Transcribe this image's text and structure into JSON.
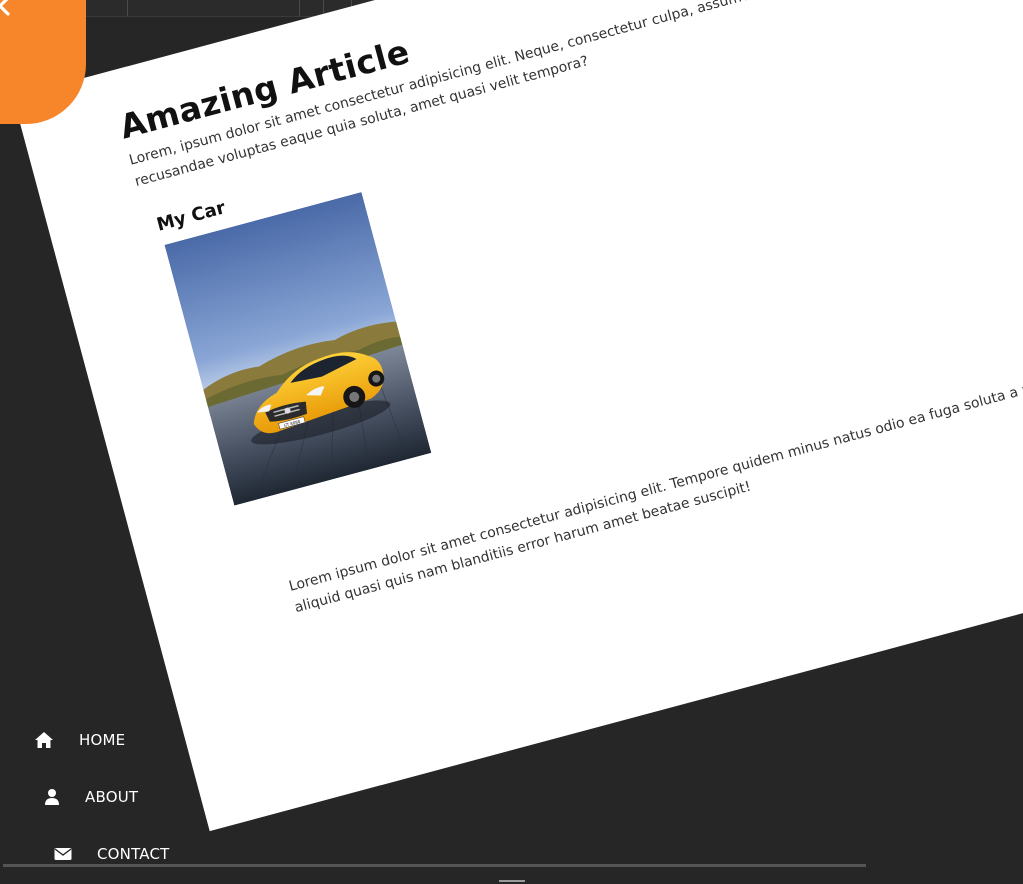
{
  "article": {
    "title": "Amazing Article",
    "intro": "Lorem, ipsum dolor sit amet consectetur adipisicing elit. Neque, consectetur culpa, assumenda, recusandae voluptas eaque quia soluta, amet quasi velit tempora?",
    "section_heading": "My Car",
    "car_plate_text": "GT 8888",
    "body": "Lorem ipsum dolor sit amet consectetur adipisicing elit. Tempore quidem minus natus odio ea fuga soluta a ullam velit, unde aliquid quasi quis nam blanditiis error harum amet beatae suscipit!"
  },
  "close_button": {
    "icon": "close-icon",
    "color": "#f7862a"
  },
  "nav": {
    "items": [
      {
        "label": "HOME",
        "icon": "home-icon"
      },
      {
        "label": "ABOUT",
        "icon": "user-icon"
      },
      {
        "label": "CONTACT",
        "icon": "envelope-icon"
      }
    ]
  },
  "colors": {
    "background": "#262626",
    "page": "#ffffff",
    "accent": "#f7862a"
  }
}
